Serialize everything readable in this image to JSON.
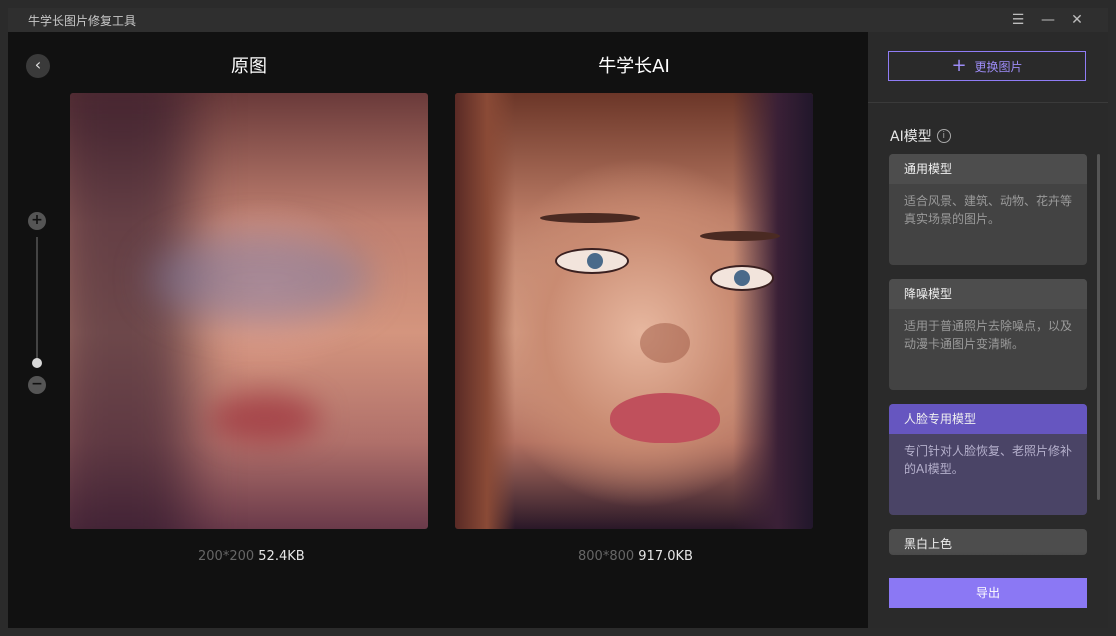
{
  "window": {
    "title": "牛学长图片修复工具",
    "menu_icon": "☰",
    "minimize_icon": "—",
    "close_icon": "✕"
  },
  "viewer": {
    "back_icon": "‹",
    "zoom_in": "+",
    "zoom_out": "−",
    "original": {
      "title": "原图",
      "dimensions": "200*200",
      "size": "52.4KB"
    },
    "enhanced": {
      "title": "牛学长AI",
      "dimensions": "800*800",
      "size": "917.0KB"
    }
  },
  "sidebar": {
    "replace_button": {
      "icon": "+",
      "label": "更换图片"
    },
    "model_heading": "AI模型",
    "info_icon": "i",
    "models": [
      {
        "title": "通用模型",
        "desc": "适合风景、建筑、动物、花卉等真实场景的图片。",
        "active": false
      },
      {
        "title": "降噪模型",
        "desc": "适用于普通照片去除噪点，以及动漫卡通图片变清晰。",
        "active": false
      },
      {
        "title": "人脸专用模型",
        "desc": "专门针对人脸恢复、老照片修补的AI模型。",
        "active": true
      },
      {
        "title": "黑白上色",
        "desc": "",
        "active": false
      }
    ],
    "export_label": "导出"
  },
  "colors": {
    "accent": "#8b78f4",
    "accent_border": "#8f7cf5",
    "active_card_header": "#6656c0",
    "background": "#111111",
    "sidebar": "#2a2a2a"
  }
}
